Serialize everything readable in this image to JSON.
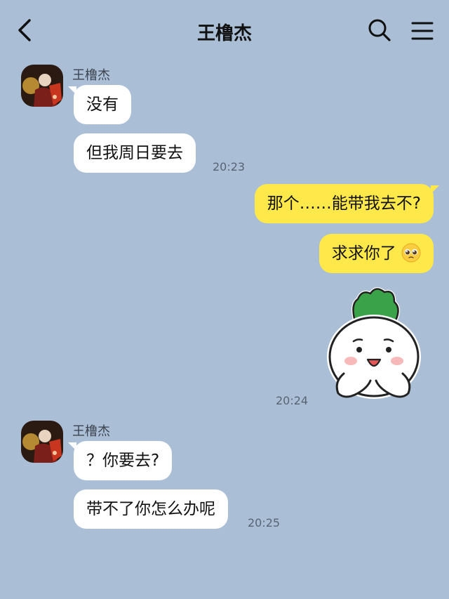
{
  "header": {
    "title": "王橹杰",
    "back_icon": "chevron-left-icon",
    "search_icon": "search-icon",
    "menu_icon": "hamburger-menu-icon"
  },
  "messages": {
    "group1": {
      "sender": "王橹杰",
      "msg1": "没有",
      "msg2": "但我周日要去",
      "time": "20:23"
    },
    "out": {
      "msg1": "那个……能带我去不?",
      "msg2": "求求你了",
      "msg2_emoji": "pleading-face-emoji",
      "sticker": "radish-sticker",
      "time": "20:24"
    },
    "group2": {
      "sender": "王橹杰",
      "msg1": "？你要去?",
      "msg2": "带不了你怎么办呢",
      "time": "20:25"
    }
  },
  "colors": {
    "background": "#aabfd6",
    "incoming_bubble": "#ffffff",
    "outgoing_bubble": "#ffe94a"
  }
}
